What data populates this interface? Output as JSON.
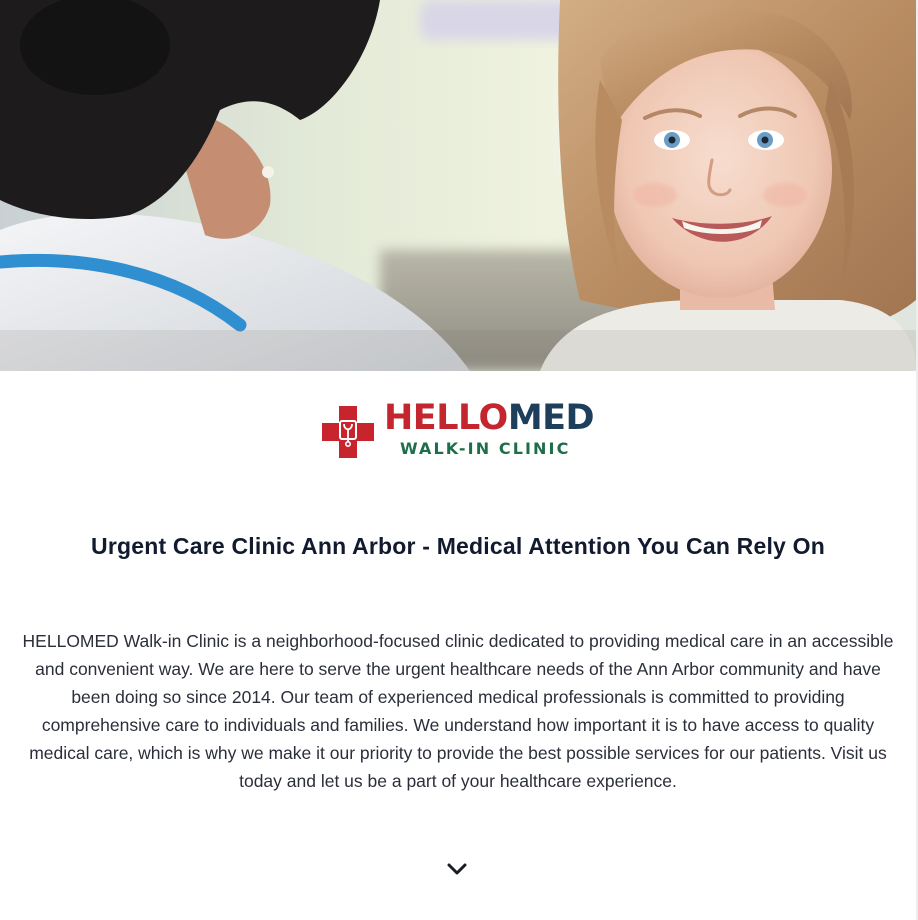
{
  "hero": {
    "image_name": "doctor-with-smiling-girl-photo"
  },
  "logo": {
    "brand_part1": "HELLO",
    "brand_part2": "MED",
    "tagline": "WALK-IN CLINIC",
    "colors": {
      "cross_red": "#c8242d",
      "hello_red": "#c3262e",
      "med_navy": "#1d3f5c",
      "tagline_green": "#1f6e4a"
    }
  },
  "main": {
    "title": "Urgent Care Clinic Ann Arbor - Medical Attention You Can Rely On",
    "description": "HELLOMED Walk-in Clinic is a neighborhood-focused clinic dedicated to providing medical care in an accessible and convenient way. We are here to serve the urgent healthcare needs of the Ann Arbor community and have been doing so since 2014. Our team of experienced medical professionals is committed to providing comprehensive care to individuals and families. We understand how important it is to have access to quality medical care, which is why we make it our priority to provide the best possible services for our patients. Visit us today and let us be a part of your healthcare experience."
  },
  "scroll": {
    "icon": "chevron-down-icon"
  }
}
